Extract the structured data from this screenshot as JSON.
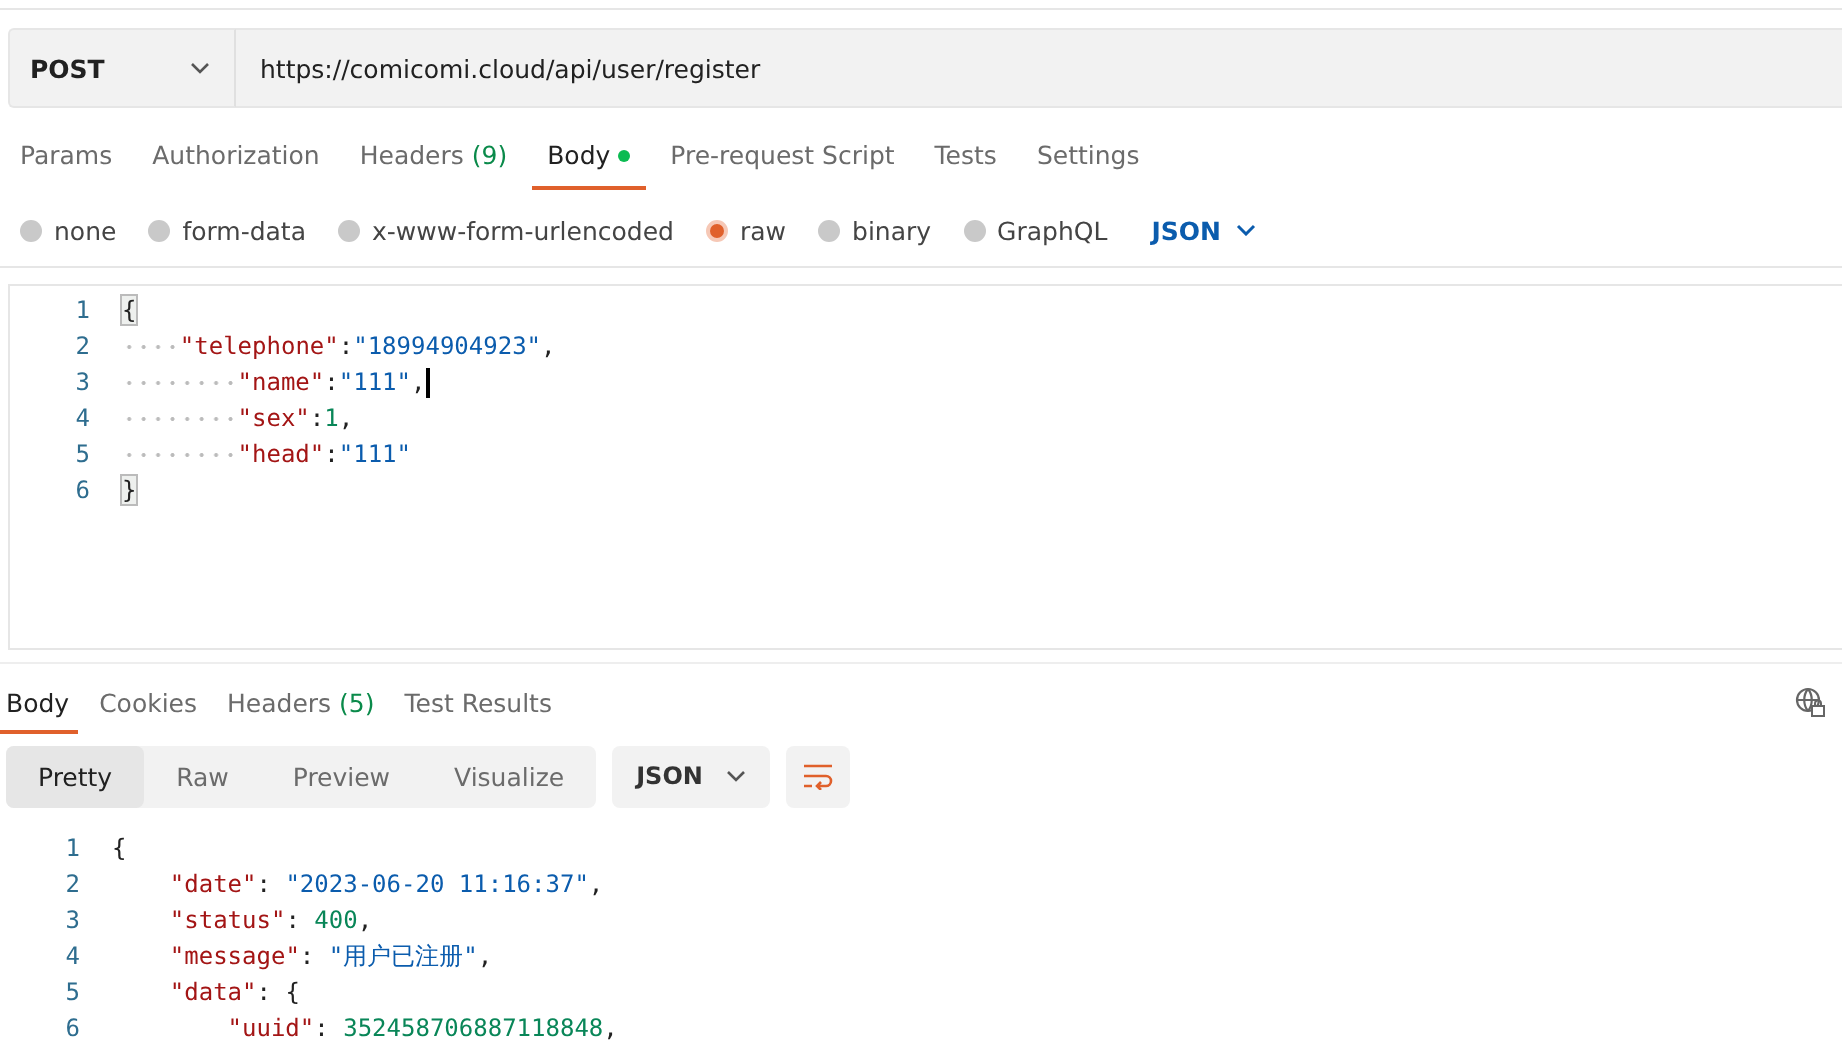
{
  "request": {
    "method": "POST",
    "url": "https://comicomi.cloud/api/user/register"
  },
  "request_tabs": [
    {
      "label": "Params",
      "selected": false,
      "dot": false
    },
    {
      "label": "Authorization",
      "selected": false,
      "dot": false
    },
    {
      "label": "Headers",
      "count": "(9)",
      "selected": false,
      "dot": false
    },
    {
      "label": "Body",
      "selected": true,
      "dot": true
    },
    {
      "label": "Pre-request Script",
      "selected": false,
      "dot": false
    },
    {
      "label": "Tests",
      "selected": false,
      "dot": false
    },
    {
      "label": "Settings",
      "selected": false,
      "dot": false
    }
  ],
  "body_types": [
    {
      "label": "none",
      "selected": false
    },
    {
      "label": "form-data",
      "selected": false
    },
    {
      "label": "x-www-form-urlencoded",
      "selected": false
    },
    {
      "label": "raw",
      "selected": true
    },
    {
      "label": "binary",
      "selected": false
    },
    {
      "label": "GraphQL",
      "selected": false
    }
  ],
  "raw_format": "JSON",
  "request_body": [
    {
      "number": "1",
      "tokens": [
        {
          "kind": "brace",
          "text": "{"
        }
      ]
    },
    {
      "number": "2",
      "tokens": [
        {
          "kind": "tab"
        },
        {
          "kind": "key",
          "text": "\"telephone\""
        },
        {
          "kind": "punct",
          "text": ":"
        },
        {
          "kind": "string",
          "text": "\"18994904923\""
        },
        {
          "kind": "punct",
          "text": ","
        }
      ]
    },
    {
      "number": "3",
      "tokens": [
        {
          "kind": "tab"
        },
        {
          "kind": "tab"
        },
        {
          "kind": "key",
          "text": "\"name\""
        },
        {
          "kind": "punct",
          "text": ":"
        },
        {
          "kind": "string",
          "text": "\"111\""
        },
        {
          "kind": "punct",
          "text": ","
        }
      ],
      "cursor": true
    },
    {
      "number": "4",
      "tokens": [
        {
          "kind": "tab"
        },
        {
          "kind": "tab"
        },
        {
          "kind": "key",
          "text": "\"sex\""
        },
        {
          "kind": "punct",
          "text": ":"
        },
        {
          "kind": "number",
          "text": "1"
        },
        {
          "kind": "punct",
          "text": ","
        }
      ]
    },
    {
      "number": "5",
      "tokens": [
        {
          "kind": "tab"
        },
        {
          "kind": "tab"
        },
        {
          "kind": "key",
          "text": "\"head\""
        },
        {
          "kind": "punct",
          "text": ":"
        },
        {
          "kind": "string",
          "text": "\"111\""
        }
      ]
    },
    {
      "number": "6",
      "tokens": [
        {
          "kind": "brace",
          "text": "}"
        }
      ]
    }
  ],
  "response_tabs": [
    {
      "label": "Body",
      "selected": true
    },
    {
      "label": "Cookies",
      "selected": false
    },
    {
      "label": "Headers",
      "count": "(5)",
      "selected": false
    },
    {
      "label": "Test Results",
      "selected": false
    }
  ],
  "view_modes": [
    {
      "label": "Pretty",
      "selected": true
    },
    {
      "label": "Raw",
      "selected": false
    },
    {
      "label": "Preview",
      "selected": false
    },
    {
      "label": "Visualize",
      "selected": false
    }
  ],
  "response_format": "JSON",
  "response_body": [
    {
      "number": "1",
      "tokens": [
        {
          "kind": "brace",
          "text": "{"
        }
      ]
    },
    {
      "number": "2",
      "tokens": [
        {
          "kind": "indent"
        },
        {
          "kind": "key",
          "text": "\"date\""
        },
        {
          "kind": "punct",
          "text": ": "
        },
        {
          "kind": "string",
          "text": "\"2023-06-20 11:16:37\""
        },
        {
          "kind": "punct",
          "text": ","
        }
      ]
    },
    {
      "number": "3",
      "tokens": [
        {
          "kind": "indent"
        },
        {
          "kind": "key",
          "text": "\"status\""
        },
        {
          "kind": "punct",
          "text": ": "
        },
        {
          "kind": "number",
          "text": "400"
        },
        {
          "kind": "punct",
          "text": ","
        }
      ]
    },
    {
      "number": "4",
      "tokens": [
        {
          "kind": "indent"
        },
        {
          "kind": "key",
          "text": "\"message\""
        },
        {
          "kind": "punct",
          "text": ": "
        },
        {
          "kind": "string",
          "text": "\"用户已注册\""
        },
        {
          "kind": "punct",
          "text": ","
        }
      ]
    },
    {
      "number": "5",
      "tokens": [
        {
          "kind": "indent"
        },
        {
          "kind": "key",
          "text": "\"data\""
        },
        {
          "kind": "punct",
          "text": ": "
        },
        {
          "kind": "brace",
          "text": "{"
        }
      ]
    },
    {
      "number": "6",
      "tokens": [
        {
          "kind": "indent"
        },
        {
          "kind": "indent"
        },
        {
          "kind": "key",
          "text": "\"uuid\""
        },
        {
          "kind": "punct",
          "text": ": "
        },
        {
          "kind": "number",
          "text": "352458706887118848"
        },
        {
          "kind": "punct",
          "text": ","
        }
      ]
    }
  ]
}
